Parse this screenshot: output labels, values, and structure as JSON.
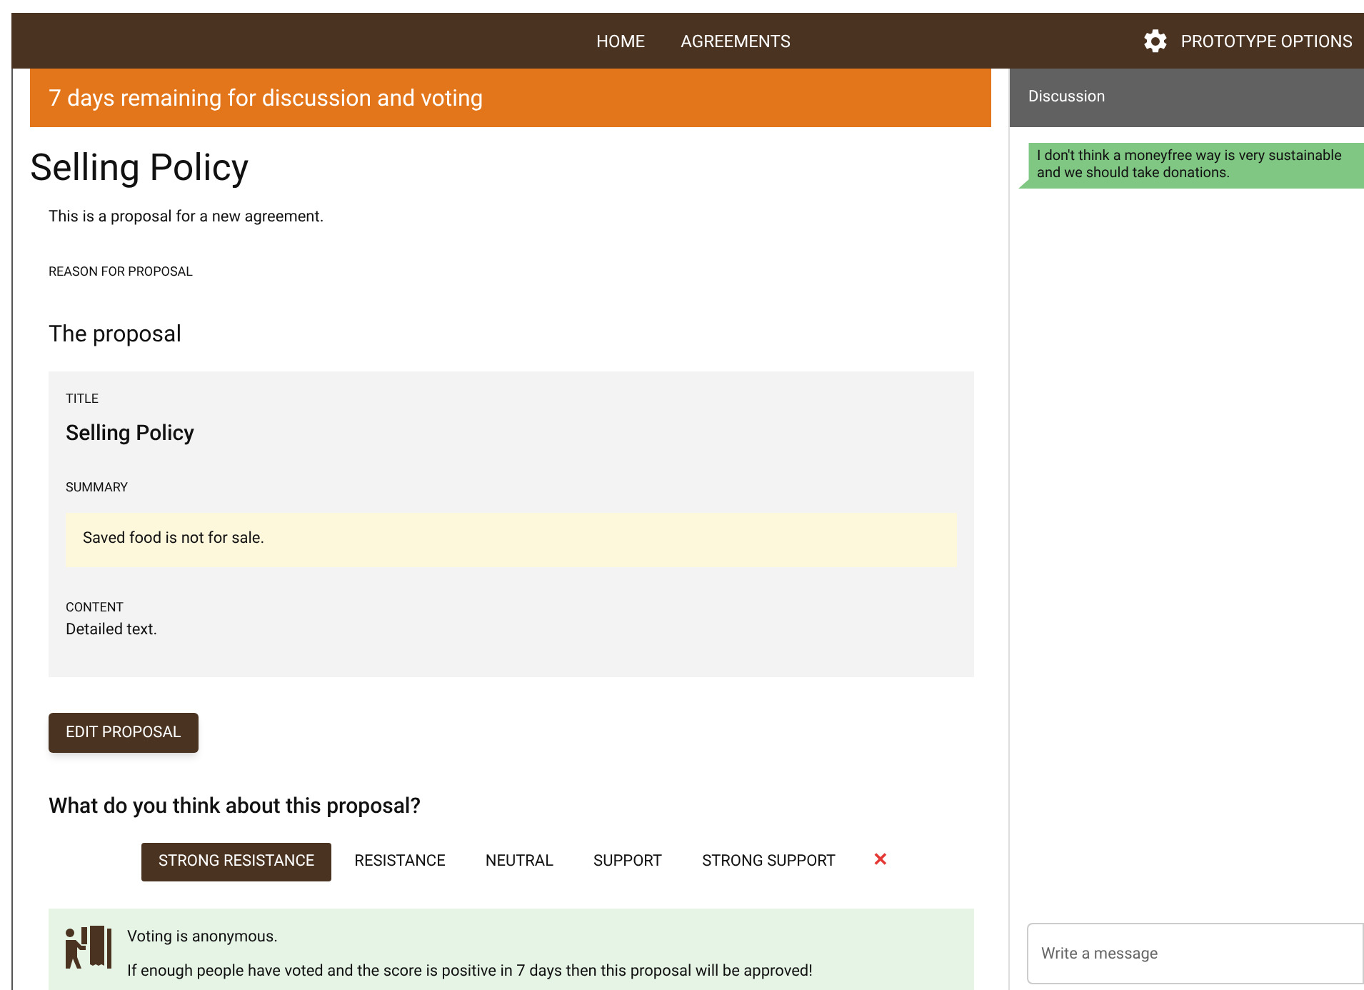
{
  "nav": {
    "links": [
      {
        "label": "HOME"
      },
      {
        "label": "AGREEMENTS"
      }
    ],
    "options": {
      "label": "PROTOTYPE OPTIONS"
    }
  },
  "banner": {
    "text": "7 days remaining for discussion and voting"
  },
  "proposal": {
    "title": "Selling Policy",
    "intro": "This is a proposal for a new agreement.",
    "reason_label": "REASON FOR PROPOSAL",
    "section_heading": "The proposal",
    "card": {
      "title_label": "TITLE",
      "title": "Selling Policy",
      "summary_label": "SUMMARY",
      "summary": "Saved food is not for sale.",
      "content_label": "CONTENT",
      "content": "Detailed text."
    },
    "edit_button": "EDIT PROPOSAL"
  },
  "vote": {
    "question": "What do you think about this proposal?",
    "options": [
      {
        "label": "STRONG RESISTANCE",
        "selected": true
      },
      {
        "label": "RESISTANCE",
        "selected": false
      },
      {
        "label": "NEUTRAL",
        "selected": false
      },
      {
        "label": "SUPPORT",
        "selected": false
      },
      {
        "label": "STRONG SUPPORT",
        "selected": false
      }
    ],
    "clear": "✕",
    "notice": [
      "Voting is anonymous.",
      "If enough people have voted and the score is positive in 7 days then this proposal will be approved!"
    ]
  },
  "discussion": {
    "title": "Discussion",
    "messages": [
      {
        "text": "I don't think a moneyfree way is very sustainable and we should take donations."
      }
    ],
    "input": {
      "placeholder": "Write a message"
    }
  }
}
